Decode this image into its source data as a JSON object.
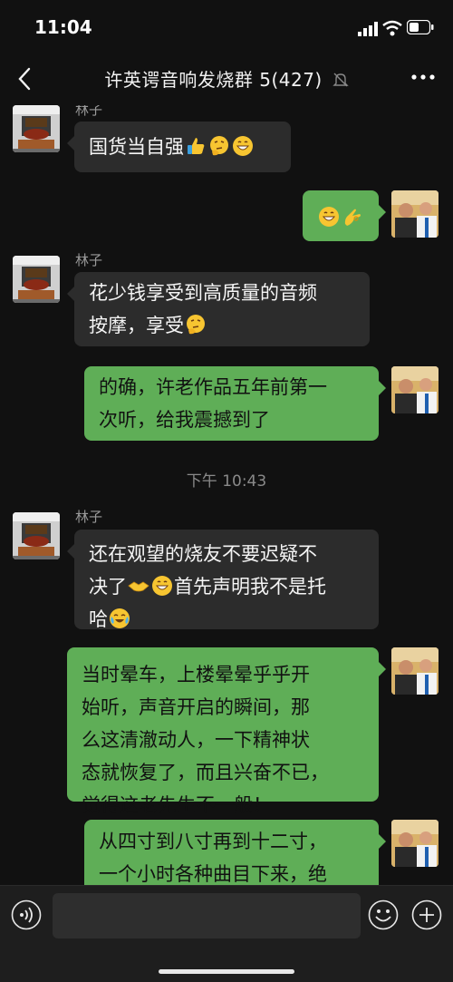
{
  "status": {
    "time": "11:04"
  },
  "header": {
    "title": "许英谔音响发烧群 5(427)"
  },
  "messages": [
    {
      "sender": "林子",
      "lines": [
        "国货当自强"
      ]
    },
    {
      "from": "me",
      "lines": []
    },
    {
      "sender": "林子",
      "lines": [
        "花少钱享受到高质量的音频",
        "按摩，享受"
      ]
    },
    {
      "from": "me",
      "lines": [
        "的确，许老作品五年前第一",
        "次听，给我震撼到了"
      ]
    },
    {
      "timestamp": "下午 10:43"
    },
    {
      "sender": "林子",
      "lines": [
        "还在观望的烧友不要迟疑不",
        "决了",
        "首先声明我不是托",
        "哈"
      ]
    },
    {
      "from": "me",
      "lines": [
        "当时晕车，上楼晕晕乎乎开",
        "始听，声音开启的瞬间，那",
        "么这清澈动人，一下精神状",
        "态就恢复了，而且兴奋不已，",
        "觉得这老先生不一般！"
      ]
    },
    {
      "from": "me",
      "lines": [
        "从四寸到八寸再到十二寸，",
        "一个小时各种曲目下来，绝"
      ]
    }
  ],
  "icons": {
    "status": [
      "signal-icon",
      "wifi-icon",
      "battery-icon"
    ],
    "nav": [
      "back-icon",
      "mute-icon",
      "more-icon"
    ],
    "input": [
      "voice-icon",
      "emoji-icon",
      "plus-icon"
    ]
  },
  "colors": {
    "background": "#111111",
    "bubble_in": "#2c2c2c",
    "bubble_out": "#5fae57"
  }
}
